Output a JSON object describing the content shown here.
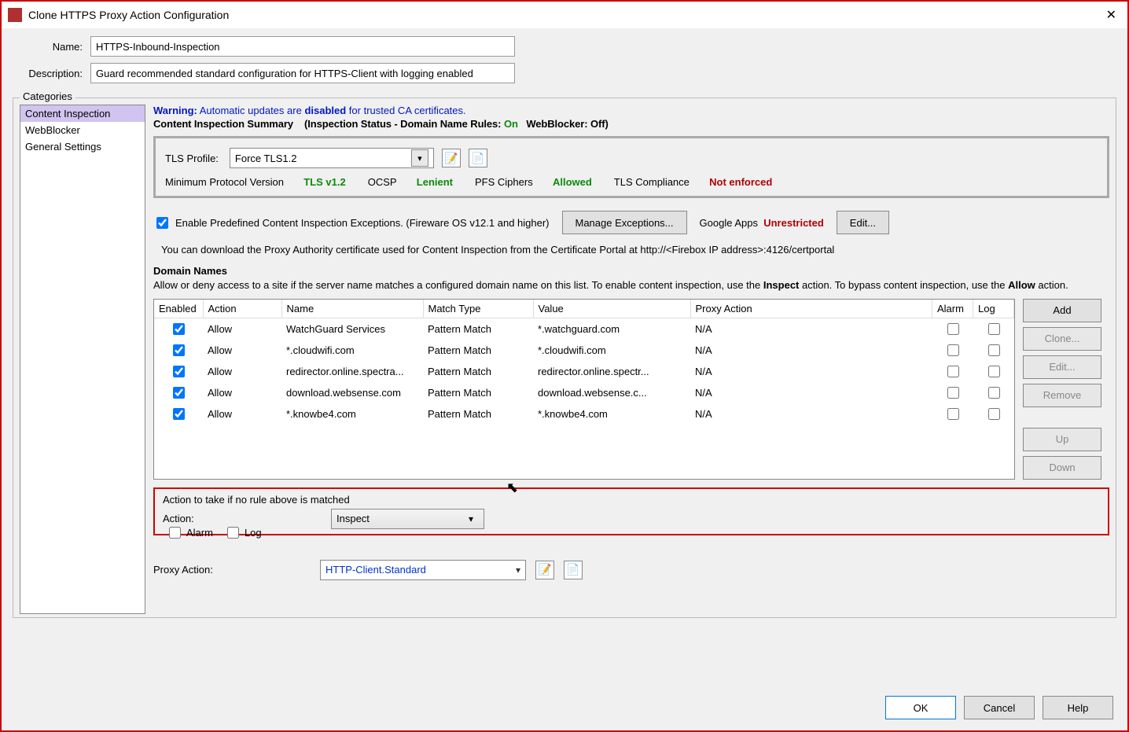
{
  "window": {
    "title": "Clone HTTPS Proxy Action Configuration"
  },
  "form": {
    "name_label": "Name:",
    "name_value": "HTTPS-Inbound-Inspection",
    "desc_label": "Description:",
    "desc_value": "Guard recommended standard configuration for HTTPS-Client with logging enabled"
  },
  "categories": {
    "legend": "Categories",
    "items": [
      {
        "label": "Content Inspection",
        "selected": true
      },
      {
        "label": "WebBlocker",
        "selected": false
      },
      {
        "label": "General Settings",
        "selected": false
      }
    ]
  },
  "warning": {
    "prefix": "Warning:",
    "text_a": " Automatic updates are ",
    "bold_b": "disabled",
    "text_c": " for trusted CA certificates."
  },
  "summary_line": {
    "title": "Content Inspection Summary",
    "sub_a": "(Inspection Status  -  Domain Name Rules:",
    "on": "On",
    "sub_b": "WebBlocker:",
    "off": "Off",
    "end": ")"
  },
  "tls": {
    "profile_label": "TLS Profile:",
    "profile_value": "Force TLS1.2",
    "min_proto_label": "Minimum Protocol Version",
    "min_proto_value": "TLS v1.2",
    "ocsp_label": "OCSP",
    "ocsp_value": "Lenient",
    "pfs_label": "PFS Ciphers",
    "pfs_value": "Allowed",
    "compliance_label": "TLS Compliance",
    "compliance_value": "Not enforced"
  },
  "exceptions": {
    "checkbox_label": "Enable Predefined Content Inspection Exceptions. (Fireware OS v12.1 and higher)",
    "manage_btn": "Manage Exceptions...",
    "google_label": "Google Apps",
    "google_value": "Unrestricted",
    "edit_btn": "Edit..."
  },
  "cert_note": "You can download the Proxy Authority certificate used for Content Inspection from the Certificate Portal at http://<Firebox IP address>:4126/certportal",
  "domain_names": {
    "header": "Domain Names",
    "desc_a": "Allow or deny access to a site if the server name matches a configured domain name on this list. To enable content inspection, use the ",
    "desc_b": "Inspect",
    "desc_c": " action. To bypass content inspection, use the ",
    "desc_d": "Allow",
    "desc_e": " action.",
    "columns": {
      "enabled": "Enabled",
      "action": "Action",
      "name": "Name",
      "match": "Match Type",
      "value": "Value",
      "proxy": "Proxy Action",
      "alarm": "Alarm",
      "log": "Log"
    },
    "rows": [
      {
        "enabled": true,
        "action": "Allow",
        "name": "WatchGuard Services",
        "match": "Pattern Match",
        "value": "*.watchguard.com",
        "proxy": "N/A"
      },
      {
        "enabled": true,
        "action": "Allow",
        "name": "*.cloudwifi.com",
        "match": "Pattern Match",
        "value": "*.cloudwifi.com",
        "proxy": "N/A"
      },
      {
        "enabled": true,
        "action": "Allow",
        "name": "redirector.online.spectra...",
        "match": "Pattern Match",
        "value": "redirector.online.spectr...",
        "proxy": "N/A"
      },
      {
        "enabled": true,
        "action": "Allow",
        "name": "download.websense.com",
        "match": "Pattern Match",
        "value": "download.websense.c...",
        "proxy": "N/A"
      },
      {
        "enabled": true,
        "action": "Allow",
        "name": "*.knowbe4.com",
        "match": "Pattern Match",
        "value": "*.knowbe4.com",
        "proxy": "N/A"
      }
    ],
    "buttons": {
      "add": "Add",
      "clone": "Clone...",
      "edit": "Edit...",
      "remove": "Remove",
      "up": "Up",
      "down": "Down"
    }
  },
  "fallback": {
    "header": "Action to take if no rule above is matched",
    "action_label": "Action:",
    "action_value": "Inspect",
    "alarm_label": "Alarm",
    "log_label": "Log",
    "proxy_label": "Proxy Action:",
    "proxy_value": "HTTP-Client.Standard"
  },
  "dialog_buttons": {
    "ok": "OK",
    "cancel": "Cancel",
    "help": "Help"
  }
}
